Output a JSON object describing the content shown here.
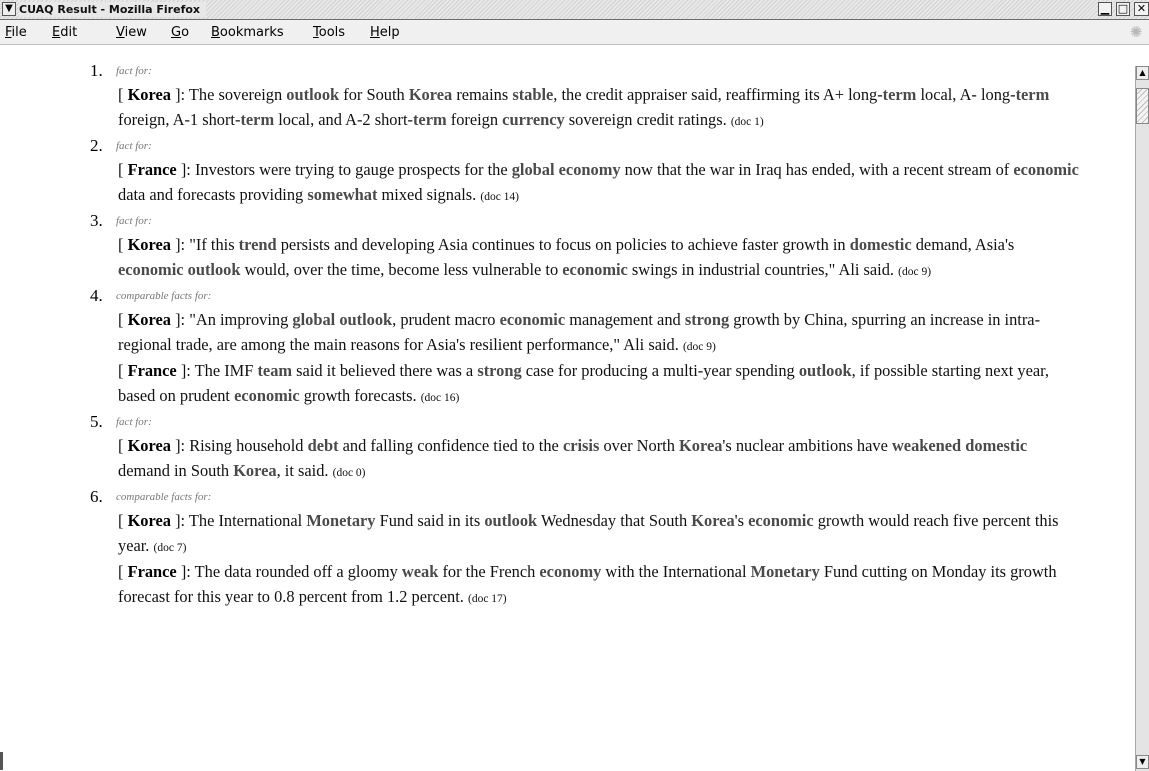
{
  "window": {
    "title": "CUAQ Result - Mozilla Firefox",
    "min_symbol": "▁",
    "max_symbol": "□",
    "close_symbol": "✕",
    "menu_symbol": "▼"
  },
  "menubar": {
    "items": [
      {
        "label_key": "F",
        "label_rest": "ile"
      },
      {
        "label_key": "E",
        "label_rest": "dit"
      },
      {
        "label_key": "V",
        "label_rest": "iew"
      },
      {
        "label_key": "G",
        "label_rest": "o"
      },
      {
        "label_key": "B",
        "label_rest": "ookmarks"
      },
      {
        "label_key": "T",
        "label_rest": "ools"
      },
      {
        "label_key": "H",
        "label_rest": "elp"
      }
    ]
  },
  "icons": {
    "throbber": "throbber-icon",
    "scroll_up": "scroll-up-arrow-icon",
    "scroll_down": "scroll-down-arrow-icon"
  },
  "results": [
    {
      "num": "1.",
      "kind": "fact for:",
      "facts": [
        {
          "entity": "Korea",
          "doc": "(doc 1)",
          "segments": [
            {
              "t": "The sovereign "
            },
            {
              "t": "outlook",
              "b": true
            },
            {
              "t": " for South "
            },
            {
              "t": "Korea",
              "b": true
            },
            {
              "t": " remains "
            },
            {
              "t": "stable",
              "b": true
            },
            {
              "t": ", the credit appraiser said, reaffirming its A+ long-"
            },
            {
              "t": "term",
              "b": true
            },
            {
              "t": " local, A- long-"
            },
            {
              "t": "term",
              "b": true
            },
            {
              "t": " foreign, A-1 short-"
            },
            {
              "t": "term",
              "b": true
            },
            {
              "t": " local, and A-2 short-"
            },
            {
              "t": "term",
              "b": true
            },
            {
              "t": " foreign "
            },
            {
              "t": "currency",
              "b": true
            },
            {
              "t": " sovereign credit ratings."
            }
          ]
        }
      ]
    },
    {
      "num": "2.",
      "kind": "fact for:",
      "facts": [
        {
          "entity": "France",
          "doc": "(doc 14)",
          "segments": [
            {
              "t": "Investors were trying to gauge prospects for the "
            },
            {
              "t": "global economy",
              "b": true
            },
            {
              "t": " now that the war in Iraq has ended, with a recent stream of "
            },
            {
              "t": "economic",
              "b": true
            },
            {
              "t": " data and forecasts providing "
            },
            {
              "t": "somewhat",
              "b": true
            },
            {
              "t": " mixed signals."
            }
          ]
        }
      ]
    },
    {
      "num": "3.",
      "kind": "fact for:",
      "facts": [
        {
          "entity": "Korea",
          "doc": "(doc 9)",
          "segments": [
            {
              "t": "\"If this "
            },
            {
              "t": "trend",
              "b": true
            },
            {
              "t": " persists and developing Asia continues to focus on policies to achieve faster growth in "
            },
            {
              "t": "domestic",
              "b": true
            },
            {
              "t": " demand, Asia's "
            },
            {
              "t": "economic outlook",
              "b": true
            },
            {
              "t": " would, over the time, become less vulnerable to "
            },
            {
              "t": "economic",
              "b": true
            },
            {
              "t": " swings in industrial countries,\" Ali said."
            }
          ]
        }
      ]
    },
    {
      "num": "4.",
      "kind": "comparable facts for:",
      "facts": [
        {
          "entity": "Korea",
          "doc": "(doc 9)",
          "segments": [
            {
              "t": "\"An improving "
            },
            {
              "t": "global outlook",
              "b": true
            },
            {
              "t": ", prudent macro "
            },
            {
              "t": "economic",
              "b": true
            },
            {
              "t": " management and "
            },
            {
              "t": "strong",
              "b": true
            },
            {
              "t": " growth by China, spurring an increase in intra- regional trade, are among the main reasons for Asia's resilient performance,\" Ali said."
            }
          ]
        },
        {
          "entity": "France",
          "doc": "(doc 16)",
          "segments": [
            {
              "t": "The IMF "
            },
            {
              "t": "team",
              "b": true
            },
            {
              "t": " said it believed there was a "
            },
            {
              "t": "strong",
              "b": true
            },
            {
              "t": " case for producing a multi-year spending "
            },
            {
              "t": "outlook",
              "b": true
            },
            {
              "t": ", if possible starting next year, based on prudent "
            },
            {
              "t": "economic",
              "b": true
            },
            {
              "t": " growth forecasts."
            }
          ]
        }
      ]
    },
    {
      "num": "5.",
      "kind": "fact for:",
      "facts": [
        {
          "entity": "Korea",
          "doc": "(doc 0)",
          "segments": [
            {
              "t": "Rising household "
            },
            {
              "t": "debt",
              "b": true
            },
            {
              "t": " and falling confidence tied to the "
            },
            {
              "t": "crisis",
              "b": true
            },
            {
              "t": " over North "
            },
            {
              "t": "Korea",
              "b": true
            },
            {
              "t": "'s nuclear ambitions have "
            },
            {
              "t": "weakened domestic",
              "b": true
            },
            {
              "t": " demand in South "
            },
            {
              "t": "Korea",
              "b": true
            },
            {
              "t": ", it said."
            }
          ]
        }
      ]
    },
    {
      "num": "6.",
      "kind": "comparable facts for:",
      "facts": [
        {
          "entity": "Korea",
          "doc": "(doc 7)",
          "segments": [
            {
              "t": "The International "
            },
            {
              "t": "Monetary",
              "b": true
            },
            {
              "t": " Fund said in its "
            },
            {
              "t": "outlook",
              "b": true
            },
            {
              "t": " Wednesday that South "
            },
            {
              "t": "Korea",
              "b": true
            },
            {
              "t": "'s "
            },
            {
              "t": "economic",
              "b": true
            },
            {
              "t": " growth would reach five percent this year."
            }
          ]
        },
        {
          "entity": "France",
          "doc": "(doc 17)",
          "segments": [
            {
              "t": "The data rounded off a gloomy "
            },
            {
              "t": "weak",
              "b": true
            },
            {
              "t": " for the French "
            },
            {
              "t": "economy",
              "b": true
            },
            {
              "t": " with the International "
            },
            {
              "t": "Monetary",
              "b": true
            },
            {
              "t": " Fund cutting on Monday its growth forecast for this year to 0.8 percent from 1.2 percent."
            }
          ]
        }
      ]
    }
  ]
}
